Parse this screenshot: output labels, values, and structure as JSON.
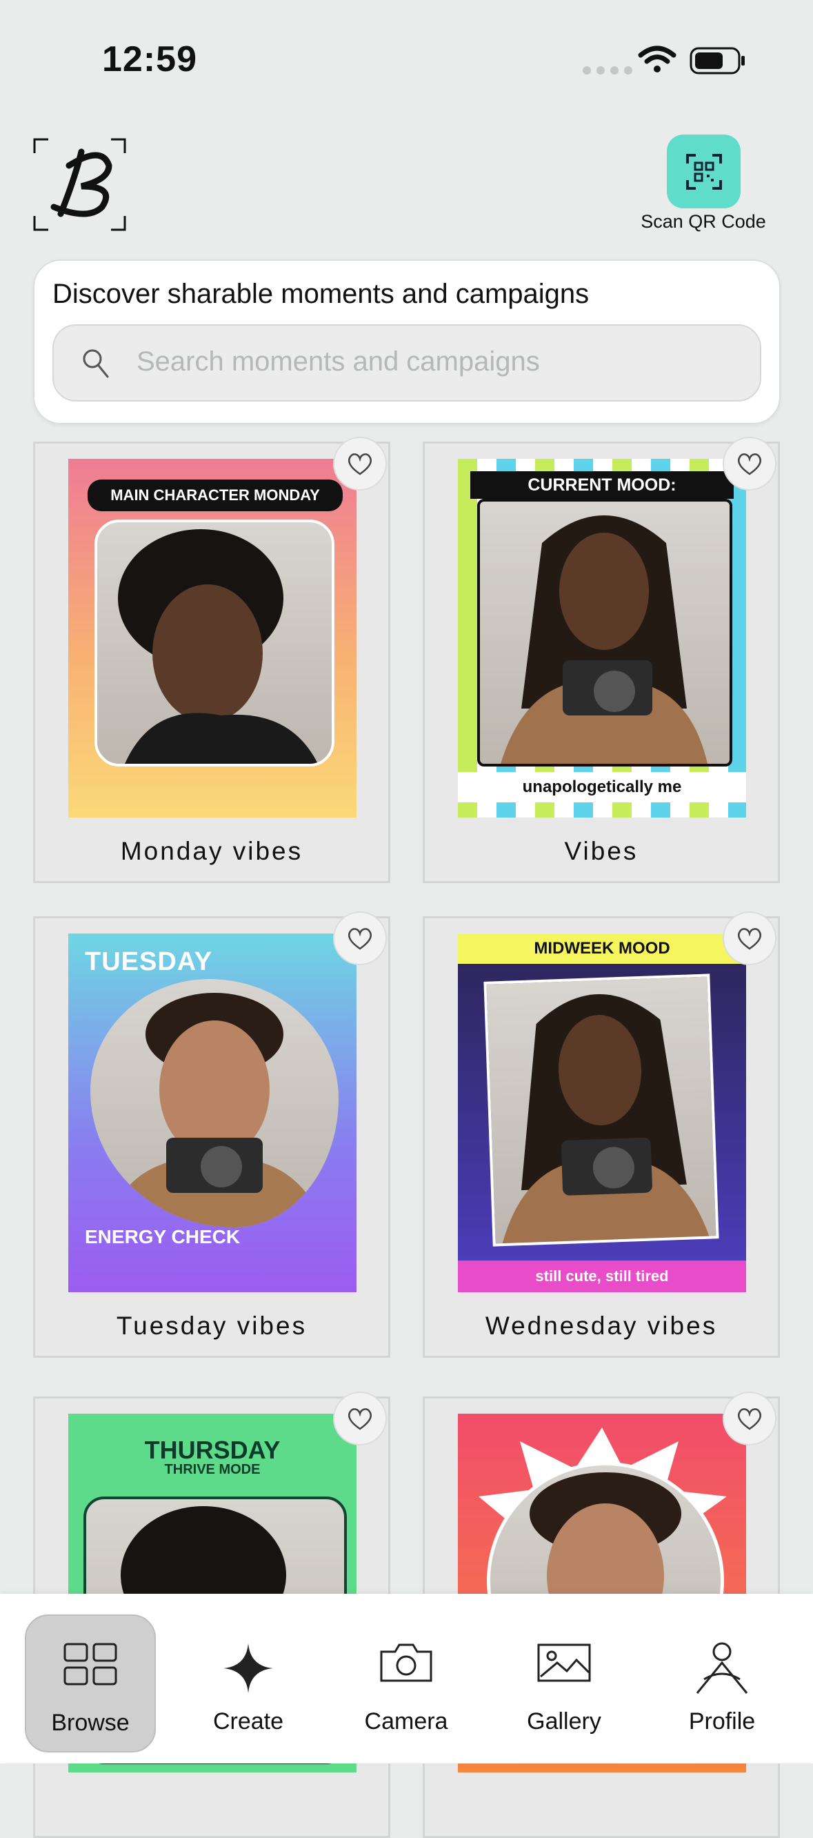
{
  "status": {
    "time": "12:59"
  },
  "header": {
    "scan_label": "Scan QR Code",
    "logo_letter": "B"
  },
  "search": {
    "title": "Discover sharable moments and campaigns",
    "placeholder": "Search moments and campaigns"
  },
  "cards": [
    {
      "caption": "Monday vibes",
      "banner": "MAIN CHARACTER MONDAY"
    },
    {
      "caption": "Vibes",
      "banner": "CURRENT MOOD:",
      "footer": "unapologetically me"
    },
    {
      "caption": "Tuesday vibes",
      "banner": "TUESDAY",
      "footer": "ENERGY CHECK"
    },
    {
      "caption": "Wednesday vibes",
      "banner": "MIDWEEK MOOD",
      "footer": "still cute, still tired"
    },
    {
      "banner": "THURSDAY",
      "sub": "THRIVE MODE"
    },
    {}
  ],
  "tabs": [
    {
      "label": "Browse",
      "icon": "grid-icon"
    },
    {
      "label": "Create",
      "icon": "sparkle-icon"
    },
    {
      "label": "Camera",
      "icon": "camera-icon"
    },
    {
      "label": "Gallery",
      "icon": "image-icon"
    },
    {
      "label": "Profile",
      "icon": "person-icon"
    }
  ]
}
